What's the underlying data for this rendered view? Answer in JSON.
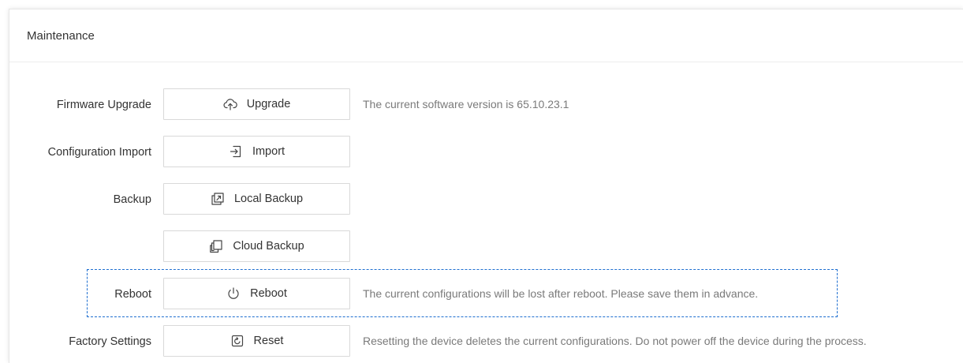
{
  "panel": {
    "title": "Maintenance"
  },
  "rows": [
    {
      "label": "Firmware Upgrade",
      "button": "Upgrade",
      "icon": "cloud-upload-icon",
      "desc": "The current software version is 65.10.23.1"
    },
    {
      "label": "Configuration Import",
      "button": "Import",
      "icon": "import-icon",
      "desc": ""
    },
    {
      "label": "Backup",
      "button": "Local Backup",
      "icon": "local-backup-icon",
      "desc": ""
    },
    {
      "label": "",
      "button": "Cloud Backup",
      "icon": "cloud-backup-icon",
      "desc": ""
    },
    {
      "label": "Reboot",
      "button": "Reboot",
      "icon": "power-icon",
      "desc": "The current configurations will be lost after reboot. Please save them in advance."
    },
    {
      "label": "Factory Settings",
      "button": "Reset",
      "icon": "reset-icon",
      "desc": "Resetting the device deletes the current configurations. Do not power off the device during the process."
    }
  ],
  "colors": {
    "highlight_border": "#1f6fd0",
    "desc_text": "#7a7a7a",
    "button_border": "#d9d9d9"
  }
}
